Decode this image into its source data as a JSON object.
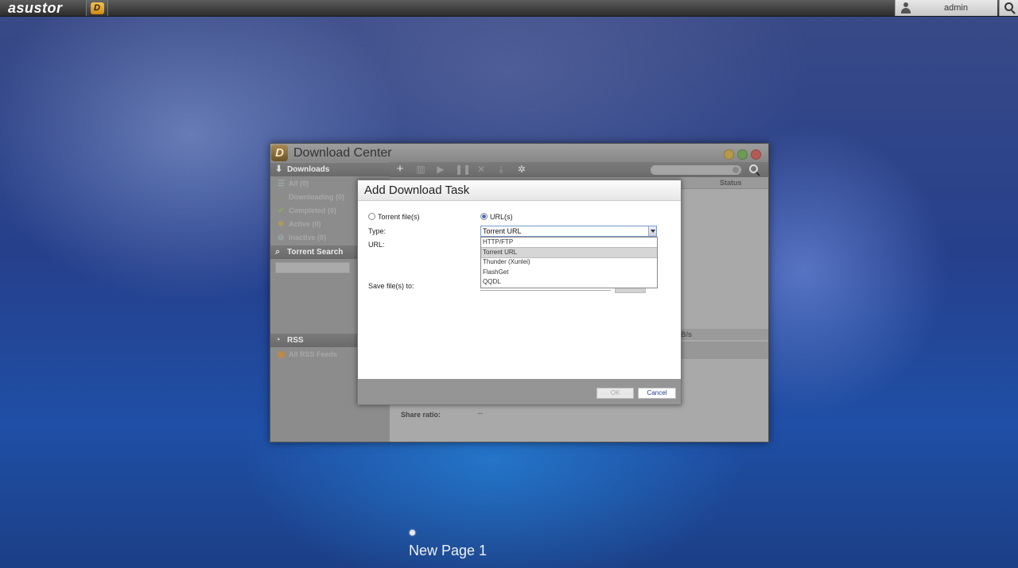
{
  "topbar": {
    "logo": "asustor",
    "app_icon_letter": "D",
    "user": "admin"
  },
  "window": {
    "title": "Download Center",
    "sidebar": {
      "downloads_header": "Downloads",
      "items": [
        {
          "label": "All (0)",
          "icon": "list-icon"
        },
        {
          "label": "Downloading (0)",
          "icon": "download-arrow-icon"
        },
        {
          "label": "Completed (0)",
          "icon": "check-icon"
        },
        {
          "label": "Active (0)",
          "icon": "gear-icon"
        },
        {
          "label": "Inactive (0)",
          "icon": "minus-circle-icon"
        }
      ],
      "torrent_search_header": "Torrent Search",
      "rss_header": "RSS",
      "rss_items": [
        {
          "label": "All RSS Feeds",
          "icon": "rss-feed-icon"
        }
      ]
    },
    "main": {
      "column_status": "Status",
      "speed_partial": "B/s",
      "detail_label": "Share ratio:",
      "detail_value": "--"
    }
  },
  "modal": {
    "title": "Add Download Task",
    "radio_torrent": "Torrent file(s)",
    "radio_url": "URL(s)",
    "selected_radio": "URL(s)",
    "type_label": "Type:",
    "type_value": "Torrent URL",
    "url_label": "URL:",
    "save_label": "Save file(s) to:",
    "type_options": [
      "HTTP/FTP",
      "Torrent URL",
      "Thunder (Xunlei)",
      "FlashGet",
      "QQDL"
    ],
    "ok_label": "OK",
    "cancel_label": "Cancel"
  },
  "desktop": {
    "page_name": "New Page 1"
  },
  "colors": {
    "selected_radio": "#4a6fc4",
    "cancel_text": "#223a8a"
  }
}
